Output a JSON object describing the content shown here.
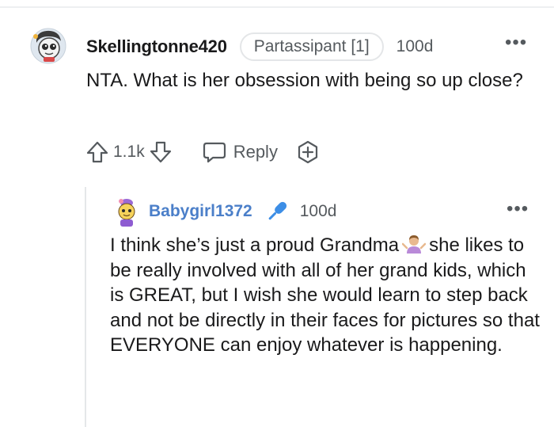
{
  "comment": {
    "username": "Skellingtonne420",
    "flair": "Partassipant [1]",
    "age": "100d",
    "body": "NTA. What is her obsession with being so up close?",
    "score": "1.1k",
    "reply_label": "Reply",
    "icons": {
      "avatar": "snoo-avatar",
      "upvote": "upvote-arrow-icon",
      "downvote": "downvote-arrow-icon",
      "reply": "speech-bubble-icon",
      "award": "add-award-icon",
      "more": "more-dots-icon"
    }
  },
  "reply": {
    "username": "Babygirl1372",
    "age": "100d",
    "body_before_emoji": "I think she’s just a proud Grandma",
    "body_after_emoji": "she likes to be really involved with all of her grand kids, which is GREAT, but I wish she would learn to step back and not be directly in their faces for pictures so that EVERYONE can enjoy whatever is happening.",
    "icons": {
      "avatar": "snoo-avatar",
      "badge": "microphone-icon",
      "emoji": "person-shrugging-emoji",
      "more": "more-dots-icon"
    }
  },
  "colors": {
    "username_link": "#4b7fc9",
    "meta_text": "#555a5e",
    "body_text": "#1a1a1b",
    "thread_line": "#e5e7e9",
    "mic_blue": "#3d8ee6"
  }
}
